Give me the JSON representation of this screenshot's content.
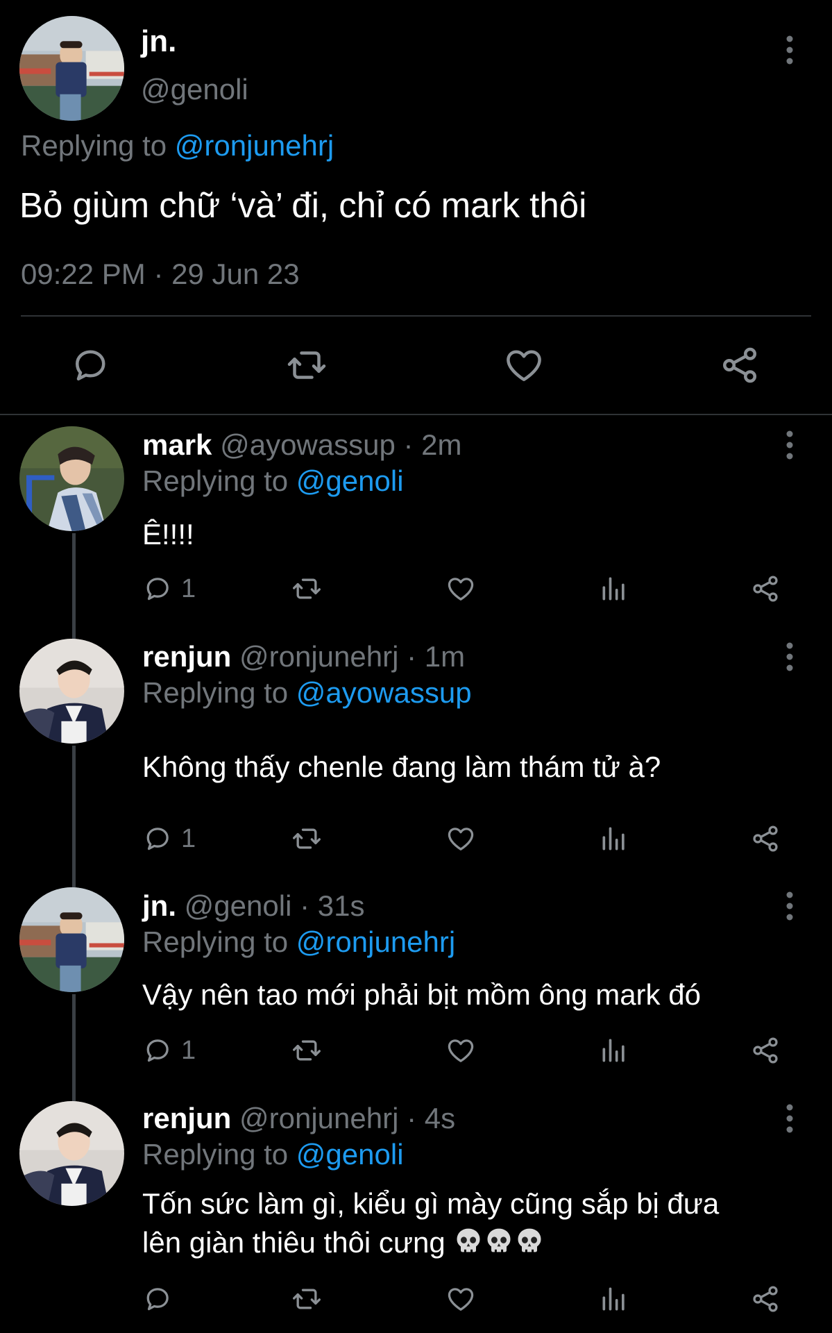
{
  "main_tweet": {
    "name": "jn.",
    "handle": "@genoli",
    "replying_prefix": "Replying to ",
    "replying_handle": "@ronjunehrj",
    "text": "Bỏ giùm chữ ‘và’ đi, chỉ có mark thôi",
    "timestamp": "09:22 PM · 29 Jun 23",
    "avatar": "jn-avatar"
  },
  "replies": [
    {
      "name": "mark",
      "handle": "@ayowassup · 2m",
      "replying_prefix": "Replying to ",
      "replying_handle": "@genoli",
      "text": "Ê!!!!",
      "reply_count": "1"
    },
    {
      "name": "renjun",
      "handle": "@ronjunehrj · 1m",
      "replying_prefix": "Replying to ",
      "replying_handle": "@ayowassup",
      "text": "Không thấy chenle đang làm thám tử à?",
      "reply_count": "1"
    },
    {
      "name": "jn.",
      "handle": "@genoli · 31s",
      "replying_prefix": "Replying to ",
      "replying_handle": "@ronjunehrj",
      "text": "Vậy nên tao mới phải bịt mồm ông mark đó",
      "reply_count": "1"
    },
    {
      "name": "renjun",
      "handle": "@ronjunehrj · 4s",
      "replying_prefix": "Replying to ",
      "replying_handle": "@genoli",
      "text_line1": "Tốn sức làm gì, kiểu gì mày cũng sắp bị đưa",
      "text_line2": "lên giàn thiêu thôi cưng",
      "emoji": "skull-emoji ×3",
      "reply_count": ""
    }
  ],
  "colors": {
    "background": "#000000",
    "text": "#ffffff",
    "secondary": "#71767b",
    "link": "#1d9bf0",
    "divider": "#2f3336",
    "icon": "#71767b"
  }
}
